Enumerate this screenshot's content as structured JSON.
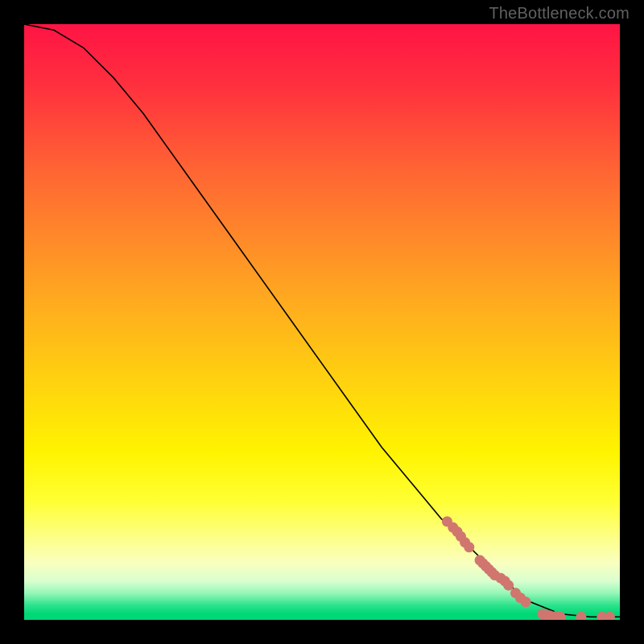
{
  "attribution": "TheBottleneck.com",
  "chart_data": {
    "type": "line",
    "title": "",
    "xlabel": "",
    "ylabel": "",
    "xlim": [
      0,
      100
    ],
    "ylim": [
      0,
      100
    ],
    "curve": [
      {
        "x": 0,
        "y": 100
      },
      {
        "x": 5,
        "y": 99
      },
      {
        "x": 10,
        "y": 96
      },
      {
        "x": 15,
        "y": 91
      },
      {
        "x": 20,
        "y": 85
      },
      {
        "x": 25,
        "y": 78
      },
      {
        "x": 30,
        "y": 71
      },
      {
        "x": 35,
        "y": 64
      },
      {
        "x": 40,
        "y": 57
      },
      {
        "x": 45,
        "y": 50
      },
      {
        "x": 50,
        "y": 43
      },
      {
        "x": 55,
        "y": 36
      },
      {
        "x": 60,
        "y": 29
      },
      {
        "x": 65,
        "y": 23
      },
      {
        "x": 70,
        "y": 17
      },
      {
        "x": 75,
        "y": 12
      },
      {
        "x": 80,
        "y": 7
      },
      {
        "x": 85,
        "y": 3
      },
      {
        "x": 90,
        "y": 1
      },
      {
        "x": 95,
        "y": 0.5
      },
      {
        "x": 100,
        "y": 0.5
      }
    ],
    "markers": [
      {
        "x": 71,
        "y": 16.5
      },
      {
        "x": 72,
        "y": 15.5
      },
      {
        "x": 72.7,
        "y": 14.8
      },
      {
        "x": 73.3,
        "y": 14
      },
      {
        "x": 74,
        "y": 13
      },
      {
        "x": 74.7,
        "y": 12.2
      },
      {
        "x": 76.5,
        "y": 10
      },
      {
        "x": 77,
        "y": 9.5
      },
      {
        "x": 77.5,
        "y": 9
      },
      {
        "x": 78,
        "y": 8.5
      },
      {
        "x": 78.5,
        "y": 8
      },
      {
        "x": 79,
        "y": 7.5
      },
      {
        "x": 80,
        "y": 7
      },
      {
        "x": 80.7,
        "y": 6.5
      },
      {
        "x": 81.3,
        "y": 5.8
      },
      {
        "x": 82.5,
        "y": 4.5
      },
      {
        "x": 83.3,
        "y": 3.7
      },
      {
        "x": 84.2,
        "y": 3
      },
      {
        "x": 87,
        "y": 1
      },
      {
        "x": 87.7,
        "y": 0.8
      },
      {
        "x": 88.3,
        "y": 0.7
      },
      {
        "x": 89.3,
        "y": 0.6
      },
      {
        "x": 90,
        "y": 0.5
      },
      {
        "x": 93.5,
        "y": 0.5
      },
      {
        "x": 97,
        "y": 0.5
      },
      {
        "x": 98.3,
        "y": 0.5
      }
    ],
    "marker_color": "#d0766f",
    "gradient_stops": [
      {
        "offset": 0.0,
        "color": "#ff1445"
      },
      {
        "offset": 0.1,
        "color": "#ff2f3e"
      },
      {
        "offset": 0.25,
        "color": "#ff6633"
      },
      {
        "offset": 0.45,
        "color": "#ffa621"
      },
      {
        "offset": 0.6,
        "color": "#ffd20f"
      },
      {
        "offset": 0.72,
        "color": "#fff400"
      },
      {
        "offset": 0.8,
        "color": "#ffff33"
      },
      {
        "offset": 0.86,
        "color": "#fdff84"
      },
      {
        "offset": 0.905,
        "color": "#f9ffbf"
      },
      {
        "offset": 0.935,
        "color": "#d9ffcf"
      },
      {
        "offset": 0.955,
        "color": "#96f7b8"
      },
      {
        "offset": 0.975,
        "color": "#2fe38d"
      },
      {
        "offset": 0.99,
        "color": "#00d877"
      }
    ]
  }
}
